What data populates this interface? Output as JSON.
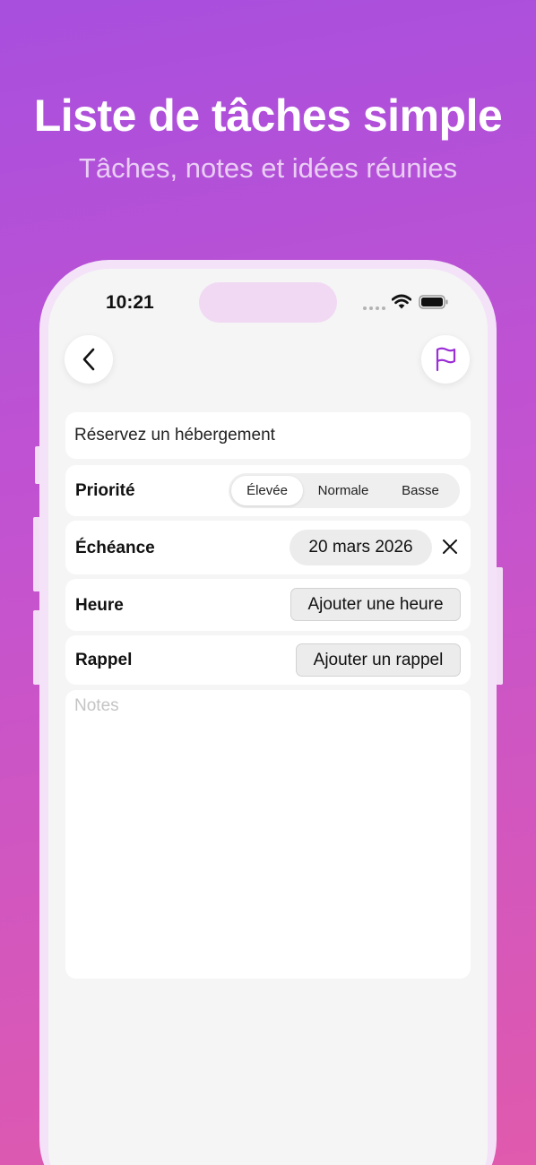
{
  "promo": {
    "title": "Liste de tâches simple",
    "subtitle": "Tâches, notes et idées réunies"
  },
  "status_bar": {
    "time": "10:21",
    "icons": [
      "signal-dots-icon",
      "wifi-icon",
      "battery-icon"
    ]
  },
  "toolbar": {
    "back_icon": "chevron-left-icon",
    "flag_icon": "flag-icon",
    "accent_color": "#9b2fd6"
  },
  "task": {
    "title": "Réservez un hébergement",
    "priority": {
      "label": "Priorité",
      "options": [
        "Élevée",
        "Normale",
        "Basse"
      ],
      "selected": "Élevée"
    },
    "due": {
      "label": "Échéance",
      "value": "20 mars 2026"
    },
    "hour": {
      "label": "Heure",
      "button": "Ajouter une heure"
    },
    "reminder": {
      "label": "Rappel",
      "button": "Ajouter un rappel"
    },
    "notes": {
      "placeholder": "Notes",
      "value": ""
    }
  }
}
